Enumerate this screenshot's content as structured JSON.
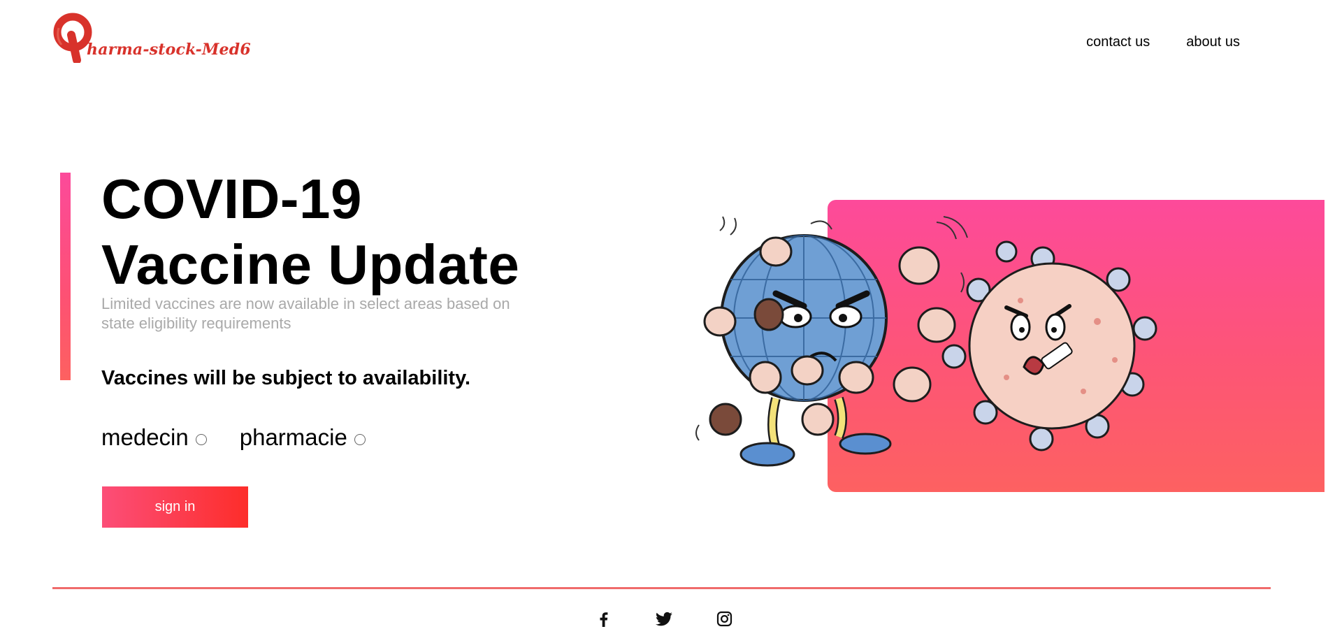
{
  "brand": {
    "name": "harma-stock-Med6",
    "logo_icon": "pharma-p-logo-icon",
    "color": "#d8322b"
  },
  "nav": {
    "contact_label": "contact us",
    "about_label": "about us"
  },
  "hero": {
    "title_line1": "COVID-19",
    "title_line2": "Vaccine Update",
    "subtitle": "Limited vaccines are now available in select areas based on state eligibility requirements",
    "note": "Vaccines will be subject to availability.",
    "roles": [
      {
        "label": "medecin",
        "checked": false
      },
      {
        "label": "pharmacie",
        "checked": false
      }
    ],
    "signin_label": "sign in",
    "illustration_icon": "earth-punching-virus-illustration"
  },
  "footer": {
    "social": [
      {
        "name": "facebook",
        "icon": "facebook-icon"
      },
      {
        "name": "twitter",
        "icon": "twitter-icon"
      },
      {
        "name": "instagram",
        "icon": "instagram-icon"
      }
    ]
  },
  "colors": {
    "accent_pink": "#fc4a9a",
    "accent_red": "#fd2d2a",
    "subtitle_gray": "#a9a9a9",
    "footer_line": "#f06b6b"
  }
}
